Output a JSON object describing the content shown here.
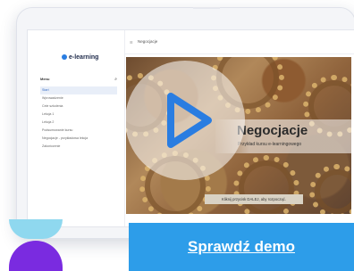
{
  "app": {
    "logo_text": "e-learning"
  },
  "sidebar": {
    "menu_title": "Menu",
    "items": [
      {
        "label": "Start"
      },
      {
        "label": "Wprowadzenie"
      },
      {
        "label": "Cele szkolenia"
      },
      {
        "label": "Lekcja 1"
      },
      {
        "label": "Lekcja 2"
      },
      {
        "label": "Podsumowanie kursu"
      },
      {
        "label": "Negocjacje - przykładowa lekcja"
      },
      {
        "label": "Zakończenie"
      }
    ]
  },
  "topbar": {
    "breadcrumb": "Negocjacje"
  },
  "slide": {
    "title": "Negocjacje",
    "subtitle": "Przykład kursu e-learningowego",
    "hint": "Kliknij przycisk DALEJ, aby rozpocząć."
  },
  "cta": {
    "label": "Sprawdź demo"
  },
  "colors": {
    "accent": "#2d9de9",
    "purple": "#7a2be0",
    "cyan": "#8fd8ef"
  },
  "icons": {
    "play": "play-icon"
  }
}
